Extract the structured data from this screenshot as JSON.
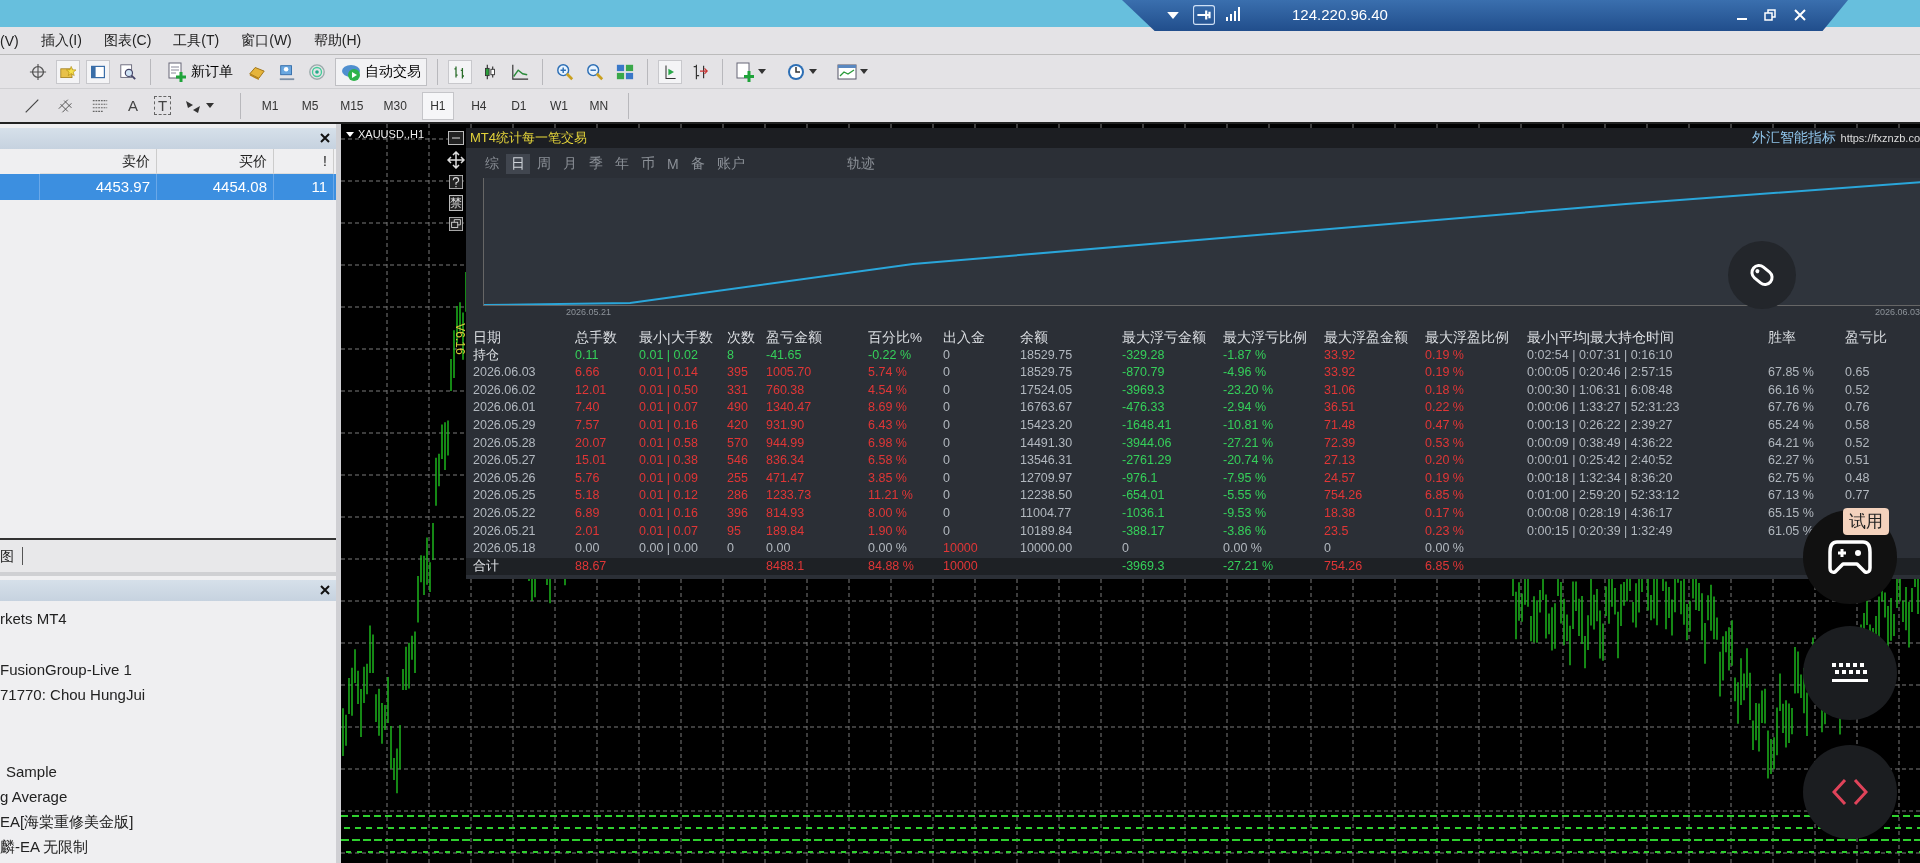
{
  "remote_bar": {
    "address": "124.220.96.40"
  },
  "menu": [
    "(V)",
    "插入(I)",
    "图表(C)",
    "工具(T)",
    "窗口(W)",
    "帮助(H)"
  ],
  "toolbar": {
    "new_order": "新订单",
    "auto_trading": "自动交易",
    "auto_trading_on": true
  },
  "drawing_tools": {
    "text_tool": "A",
    "label_tool": "T"
  },
  "timeframes": [
    {
      "label": "M1",
      "selected": false
    },
    {
      "label": "M5",
      "selected": false
    },
    {
      "label": "M15",
      "selected": false
    },
    {
      "label": "M30",
      "selected": false
    },
    {
      "label": "H1",
      "selected": true
    },
    {
      "label": "H4",
      "selected": false
    },
    {
      "label": "D1",
      "selected": false
    },
    {
      "label": "W1",
      "selected": false
    },
    {
      "label": "MN",
      "selected": false
    }
  ],
  "market_watch": {
    "columns": [
      "卖价",
      "买价",
      "!"
    ],
    "rows": [
      {
        "bid": "4453.97",
        "ask": "4454.08",
        "spread": "11",
        "selected": true
      }
    ]
  },
  "panel_tabs": [
    "图"
  ],
  "navigator": {
    "items": [
      {
        "label": "rkets MT4"
      },
      {
        "label": "FusionGroup-Live 1"
      },
      {
        "label": "71770: Chou HungJui"
      },
      {
        "label": "Sample"
      },
      {
        "label": "g Average"
      },
      {
        "label": "EA[海棠重修美金版]"
      },
      {
        "label": "麟-EA 无限制"
      }
    ]
  },
  "chart": {
    "symbol": "XAUUSD.,H1",
    "version": "V6.16",
    "side_button": "禁"
  },
  "stats_panel": {
    "title": "MT4统计每一笔交易",
    "brand": "外汇智能指标",
    "url": "https://fxznzb.co",
    "tabs": [
      {
        "label": "综",
        "selected": false
      },
      {
        "label": "日",
        "selected": true
      },
      {
        "label": "周",
        "selected": false
      },
      {
        "label": "月",
        "selected": false
      },
      {
        "label": "季",
        "selected": false
      },
      {
        "label": "年",
        "selected": false
      },
      {
        "label": "币",
        "selected": false
      },
      {
        "label": "M",
        "selected": false
      },
      {
        "label": "备",
        "selected": false
      },
      {
        "label": "账户",
        "selected": false
      },
      {
        "label": "轨迹",
        "selected": false
      }
    ],
    "equity_curve": {
      "start_label": "2026.05.21",
      "end_label": "2026.06.03"
    },
    "table": {
      "columns": [
        "日期",
        "总手数",
        "最小|大手数",
        "次数",
        "盈亏金额",
        "百分比%",
        "出入金",
        "余额",
        "最大浮亏金额",
        "最大浮亏比例",
        "最大浮盈金额",
        "最大浮盈比例",
        "最小|平均|最大持仓时间",
        "胜率",
        "盈亏比"
      ],
      "rows": [
        {
          "kind": "open",
          "date": "持仓",
          "lots": "0.11",
          "min_max_lots": "0.01 | 0.02",
          "trades": "8",
          "pnl": "-41.65",
          "pct": "-0.22 %",
          "deposit": "0",
          "balance": "18529.75",
          "max_float_loss": "-329.28",
          "max_float_loss_pct": "-1.87 %",
          "max_float_profit": "33.92",
          "max_float_profit_pct": "0.19 %",
          "hold_time": "0:02:54 | 0:07:31 | 0:16:10"
        },
        {
          "kind": "day",
          "date": "2026.06.03",
          "lots": "6.66",
          "min_max_lots": "0.01 | 0.14",
          "trades": "395",
          "pnl": "1005.70",
          "pct": "5.74 %",
          "deposit": "0",
          "balance": "18529.75",
          "max_float_loss": "-870.79",
          "max_float_loss_pct": "-4.96 %",
          "max_float_profit": "33.92",
          "max_float_profit_pct": "0.19 %",
          "hold_time": "0:00:05 | 0:20:46 | 2:57:15",
          "win_rate": "67.85 %",
          "pl_ratio": "0.65"
        },
        {
          "kind": "day",
          "date": "2026.06.02",
          "lots": "12.01",
          "min_max_lots": "0.01 | 0.50",
          "trades": "331",
          "pnl": "760.38",
          "pct": "4.54 %",
          "deposit": "0",
          "balance": "17524.05",
          "max_float_loss": "-3969.3",
          "max_float_loss_pct": "-23.20 %",
          "max_float_profit": "31.06",
          "max_float_profit_pct": "0.18 %",
          "hold_time": "0:00:30 | 1:06:31 | 6:08:48",
          "win_rate": "66.16 %",
          "pl_ratio": "0.52"
        },
        {
          "kind": "day",
          "date": "2026.06.01",
          "lots": "7.40",
          "min_max_lots": "0.01 | 0.07",
          "trades": "490",
          "pnl": "1340.47",
          "pct": "8.69 %",
          "deposit": "0",
          "balance": "16763.67",
          "max_float_loss": "-476.33",
          "max_float_loss_pct": "-2.94 %",
          "max_float_profit": "36.51",
          "max_float_profit_pct": "0.22 %",
          "hold_time": "0:00:06 | 1:33:27 | 52:31:23",
          "win_rate": "67.76 %",
          "pl_ratio": "0.76"
        },
        {
          "kind": "day",
          "date": "2026.05.29",
          "lots": "7.57",
          "min_max_lots": "0.01 | 0.16",
          "trades": "420",
          "pnl": "931.90",
          "pct": "6.43 %",
          "deposit": "0",
          "balance": "15423.20",
          "max_float_loss": "-1648.41",
          "max_float_loss_pct": "-10.81 %",
          "max_float_profit": "71.48",
          "max_float_profit_pct": "0.47 %",
          "hold_time": "0:00:13 | 0:26:22 | 2:39:27",
          "win_rate": "65.24 %",
          "pl_ratio": "0.58"
        },
        {
          "kind": "day",
          "date": "2026.05.28",
          "lots": "20.07",
          "min_max_lots": "0.01 | 0.58",
          "trades": "570",
          "pnl": "944.99",
          "pct": "6.98 %",
          "deposit": "0",
          "balance": "14491.30",
          "max_float_loss": "-3944.06",
          "max_float_loss_pct": "-27.21 %",
          "max_float_profit": "72.39",
          "max_float_profit_pct": "0.53 %",
          "hold_time": "0:00:09 | 0:38:49 | 4:36:22",
          "win_rate": "64.21 %",
          "pl_ratio": "0.52"
        },
        {
          "kind": "day",
          "date": "2026.05.27",
          "lots": "15.01",
          "min_max_lots": "0.01 | 0.38",
          "trades": "546",
          "pnl": "836.34",
          "pct": "6.58 %",
          "deposit": "0",
          "balance": "13546.31",
          "max_float_loss": "-2761.29",
          "max_float_loss_pct": "-20.74 %",
          "max_float_profit": "27.13",
          "max_float_profit_pct": "0.20 %",
          "hold_time": "0:00:01 | 0:25:42 | 2:40:52",
          "win_rate": "62.27 %",
          "pl_ratio": "0.51"
        },
        {
          "kind": "day",
          "date": "2026.05.26",
          "lots": "5.76",
          "min_max_lots": "0.01 | 0.09",
          "trades": "255",
          "pnl": "471.47",
          "pct": "3.85 %",
          "deposit": "0",
          "balance": "12709.97",
          "max_float_loss": "-976.1",
          "max_float_loss_pct": "-7.95 %",
          "max_float_profit": "24.57",
          "max_float_profit_pct": "0.19 %",
          "hold_time": "0:00:18 | 1:32:34 | 8:36:20",
          "win_rate": "62.75 %",
          "pl_ratio": "0.48"
        },
        {
          "kind": "day",
          "date": "2026.05.25",
          "lots": "5.18",
          "min_max_lots": "0.01 | 0.12",
          "trades": "286",
          "pnl": "1233.73",
          "pct": "11.21 %",
          "deposit": "0",
          "balance": "12238.50",
          "max_float_loss": "-654.01",
          "max_float_loss_pct": "-5.55 %",
          "max_float_profit": "754.26",
          "max_float_profit_pct": "6.85 %",
          "hold_time": "0:01:00 | 2:59:20 | 52:33:12",
          "win_rate": "67.13 %",
          "pl_ratio": "0.77"
        },
        {
          "kind": "day",
          "date": "2026.05.22",
          "lots": "6.89",
          "min_max_lots": "0.01 | 0.16",
          "trades": "396",
          "pnl": "814.93",
          "pct": "8.00 %",
          "deposit": "0",
          "balance": "11004.77",
          "max_float_loss": "-1036.1",
          "max_float_loss_pct": "-9.53 %",
          "max_float_profit": "18.38",
          "max_float_profit_pct": "0.17 %",
          "hold_time": "0:00:08 | 0:28:19 | 4:36:17",
          "win_rate": "65.15 %"
        },
        {
          "kind": "day",
          "date": "2026.05.21",
          "lots": "2.01",
          "min_max_lots": "0.01 | 0.07",
          "trades": "95",
          "pnl": "189.84",
          "pct": "1.90 %",
          "deposit": "0",
          "balance": "10189.84",
          "max_float_loss": "-388.17",
          "max_float_loss_pct": "-3.86 %",
          "max_float_profit": "23.5",
          "max_float_profit_pct": "0.23 %",
          "hold_time": "0:00:15 | 0:20:39 | 1:32:49",
          "win_rate": "61.05 %"
        },
        {
          "kind": "start",
          "date": "2026.05.18",
          "lots": "0.00",
          "min_max_lots": "0.00 | 0.00",
          "trades": "0",
          "pnl": "0.00",
          "pct": "0.00 %",
          "deposit": "10000",
          "balance": "10000.00",
          "max_float_loss": "0",
          "max_float_loss_pct": "0.00 %",
          "max_float_profit": "0",
          "max_float_profit_pct": "0.00 %"
        },
        {
          "kind": "total",
          "date": "合计",
          "lots": "88.67",
          "pnl": "8488.1",
          "pct": "84.88 %",
          "deposit": "10000",
          "max_float_loss": "-3969.3",
          "max_float_loss_pct": "-27.21 %",
          "max_float_profit": "754.26",
          "max_float_profit_pct": "6.85 %"
        }
      ]
    }
  },
  "overlay": {
    "trial_badge": "试用"
  }
}
